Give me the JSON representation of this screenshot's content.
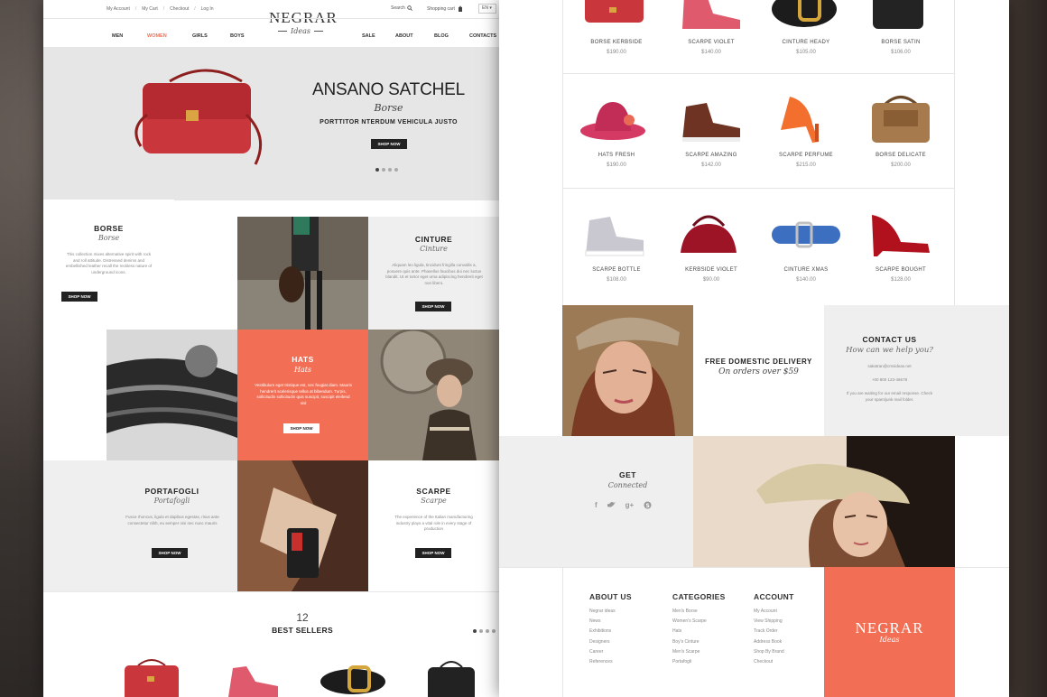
{
  "header": {
    "top_links": [
      "My Account",
      "My Cart",
      "Checkout",
      "Log In"
    ],
    "search_label": "Search",
    "cart_label": "Shopping cart",
    "lang": "EN",
    "logo_name": "NEGRAR",
    "logo_tag": "Ideas",
    "nav_left": [
      "MEN",
      "WOMEN",
      "GIRLS",
      "BOYS"
    ],
    "nav_right": [
      "SALE",
      "ABOUT",
      "BLOG",
      "CONTACTS"
    ]
  },
  "hero": {
    "title": "ANSANO SATCHEL",
    "script": "Borse",
    "subtitle": "PORTTITOR NTERDUM VEHICULA JUSTO",
    "button": "SHOP NOW"
  },
  "categories": {
    "borse": {
      "title": "BORSE",
      "script": "Borse",
      "desc": "This collection mixes alternative spirit with rock and roll attitude. Distressed denims and embellished leather recall the reckless nature of underground icons.",
      "button": "SHOP NOW"
    },
    "cinture": {
      "title": "CINTURE",
      "script": "Cinture",
      "desc": "Aliquam leo ligula, tincidunt fringilla convallis a, posuere quis ante. Phasellus faucibus dui nec luctus blandit. Ut et tortor eget urna adipiscing hendrerit eget non libero.",
      "button": "SHOP NOW"
    },
    "hats": {
      "title": "HATS",
      "script": "Hats",
      "desc": "Vestibulum eget tristique est, nec feugiat diam. Mauris hendrerit scelerisque tellus at bibendum. Turpis, sollicitudin sollicitudin quis suscipit, suscipit eleifend nisl",
      "button": "SHOP NOW"
    },
    "portafogli": {
      "title": "PORTAFOGLI",
      "script": "Portafogli",
      "desc": "Fusce rhoncus, ligula et dapibus egestas, risus ante consectetur nibh, eu semper nisi nec nunc mauris",
      "button": "SHOP NOW"
    },
    "scarpe": {
      "title": "SCARPE",
      "script": "Scarpe",
      "desc": "The experience of the Italian manufacturing industry plays a vital role in every stage of production",
      "button": "SHOP NOW"
    }
  },
  "bestsellers": {
    "count": "12",
    "title": "BEST SELLERS"
  },
  "products": [
    {
      "name": "BORSE KERBSIDE",
      "price": "$190.00"
    },
    {
      "name": "SCARPE VIOLET",
      "price": "$140.00"
    },
    {
      "name": "CINTURE HEADY",
      "price": "$105.00"
    },
    {
      "name": "BORSE SATIN",
      "price": "$106.00"
    },
    {
      "name": "HATS FRESH",
      "price": "$190.00"
    },
    {
      "name": "SCARPE AMAZING",
      "price": "$142.00"
    },
    {
      "name": "SCARPE PERFUME",
      "price": "$215.00"
    },
    {
      "name": "BORSE DELICATE",
      "price": "$200.00"
    },
    {
      "name": "SCARPE BOTTLE",
      "price": "$108.00"
    },
    {
      "name": "KERBSIDE VIOLET",
      "price": "$90.00"
    },
    {
      "name": "CINTURE XMAS",
      "price": "$140.00"
    },
    {
      "name": "SCARPE BOUGHT",
      "price": "$128.00"
    }
  ],
  "delivery": {
    "title": "FREE DOMESTIC DELIVERY",
    "script": "On orders over $59"
  },
  "contact": {
    "title": "CONTACT US",
    "script": "How can we help you?",
    "email": "sakatran@cmsideas.net",
    "phone": "+00 800 123-45678",
    "note": "If you are waiting for our email response. Check your spam/junk mail folder."
  },
  "social": {
    "title": "GET",
    "script": "Connected"
  },
  "footer": {
    "about": {
      "title": "ABOUT US",
      "items": [
        "Negrar ideas",
        "News",
        "Exhibitions",
        "Designers",
        "Career",
        "References"
      ]
    },
    "categories": {
      "title": "CATEGORIES",
      "items": [
        "Men's Borse",
        "Women's Scarpe",
        "Hats",
        "Boy's Cinture",
        "Men's Scarpe",
        "Portafogli"
      ]
    },
    "account": {
      "title": "ACCOUNT",
      "items": [
        "My Account",
        "View Shipping",
        "Track Order",
        "Address Book",
        "Shop By Brand",
        "Checkout"
      ]
    },
    "logo_name": "NEGRAR",
    "logo_tag": "Ideas"
  },
  "colors": {
    "accent": "#f26f55",
    "dark": "#222222",
    "light": "#efefef"
  }
}
